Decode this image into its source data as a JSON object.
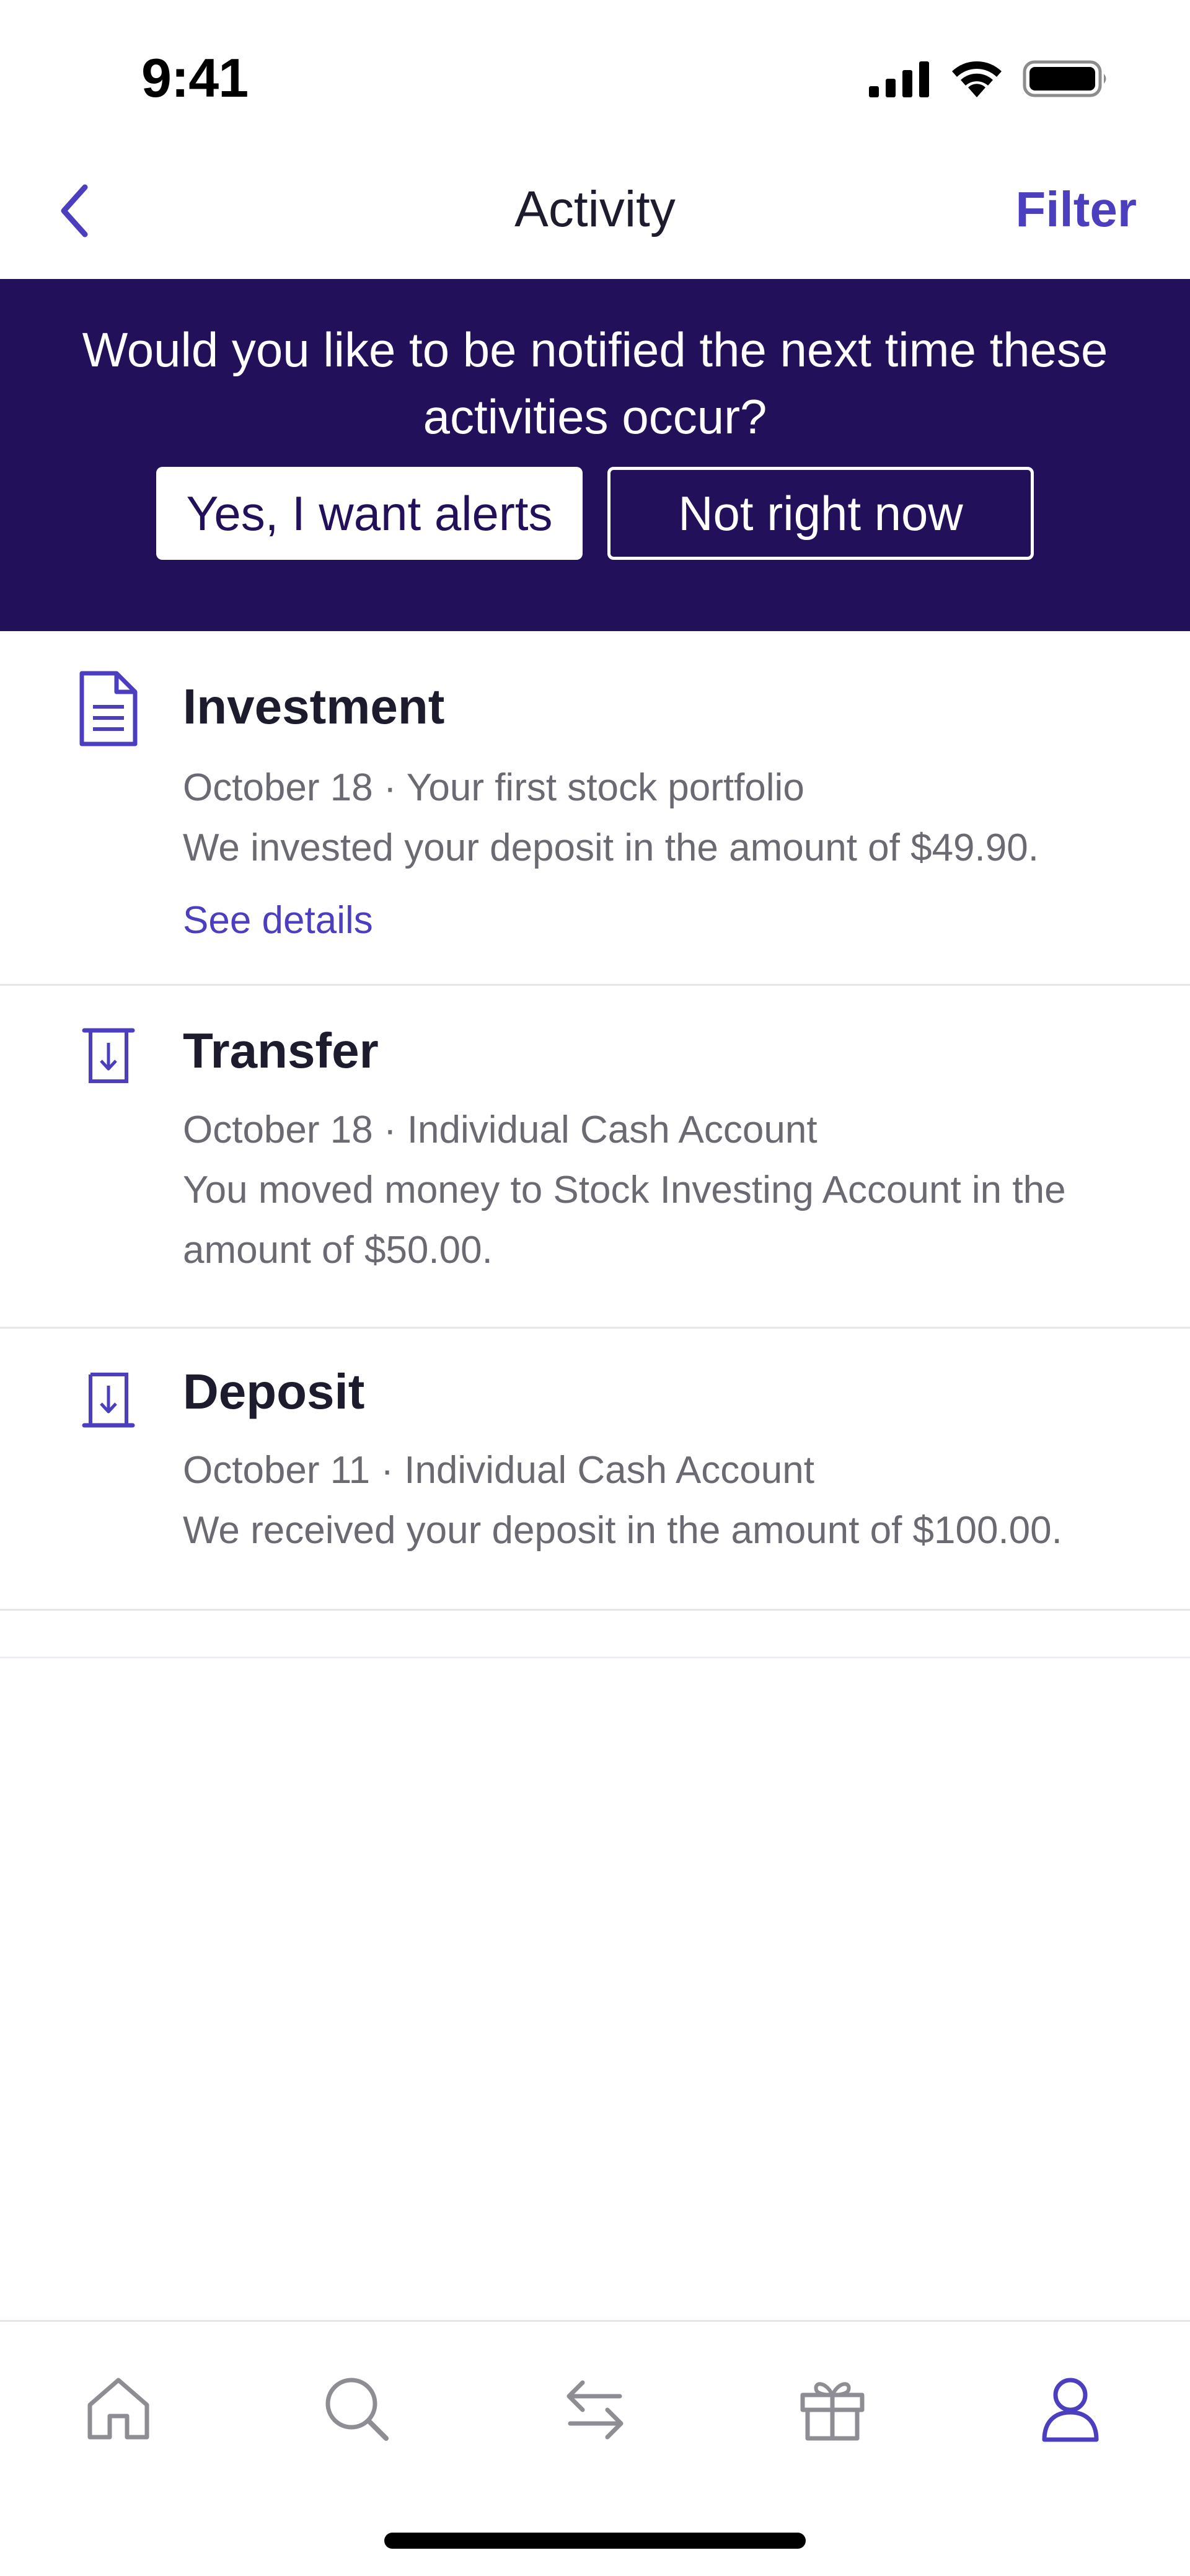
{
  "status_bar": {
    "time": "9:41",
    "icons": [
      "cellular-signal-icon",
      "wifi-icon",
      "battery-icon"
    ]
  },
  "nav": {
    "back_icon": "chevron-left-icon",
    "title": "Activity",
    "filter_label": "Filter"
  },
  "banner": {
    "message": "Would you like to be notified the next time these activities occur?",
    "accept_label": "Yes, I want alerts",
    "decline_label": "Not right now"
  },
  "activities": [
    {
      "icon": "document-icon",
      "title": "Investment",
      "meta": "October 18 · Your first stock portfolio",
      "description": "We invested your deposit in the amount of $49.90.",
      "link_label": "See details"
    },
    {
      "icon": "transfer-icon",
      "title": "Transfer",
      "meta": "October 18 · Individual Cash Account",
      "description": "You moved money to Stock Investing Account in the amount of $50.00."
    },
    {
      "icon": "deposit-icon",
      "title": "Deposit",
      "meta": "October 11 · Individual Cash Account",
      "description": "We received your deposit in the amount of $100.00."
    }
  ],
  "tab_bar": {
    "tabs": [
      {
        "icon": "home-icon",
        "active": false
      },
      {
        "icon": "search-icon",
        "active": false
      },
      {
        "icon": "transfer-arrows-icon",
        "active": false
      },
      {
        "icon": "gift-icon",
        "active": false
      },
      {
        "icon": "profile-icon",
        "active": true
      }
    ]
  },
  "colors": {
    "accent": "#4b3fc0",
    "banner_bg": "#22105a",
    "text_primary": "#1d1b2e",
    "text_secondary": "#6b6a73",
    "tab_inactive": "#8e8d94"
  }
}
